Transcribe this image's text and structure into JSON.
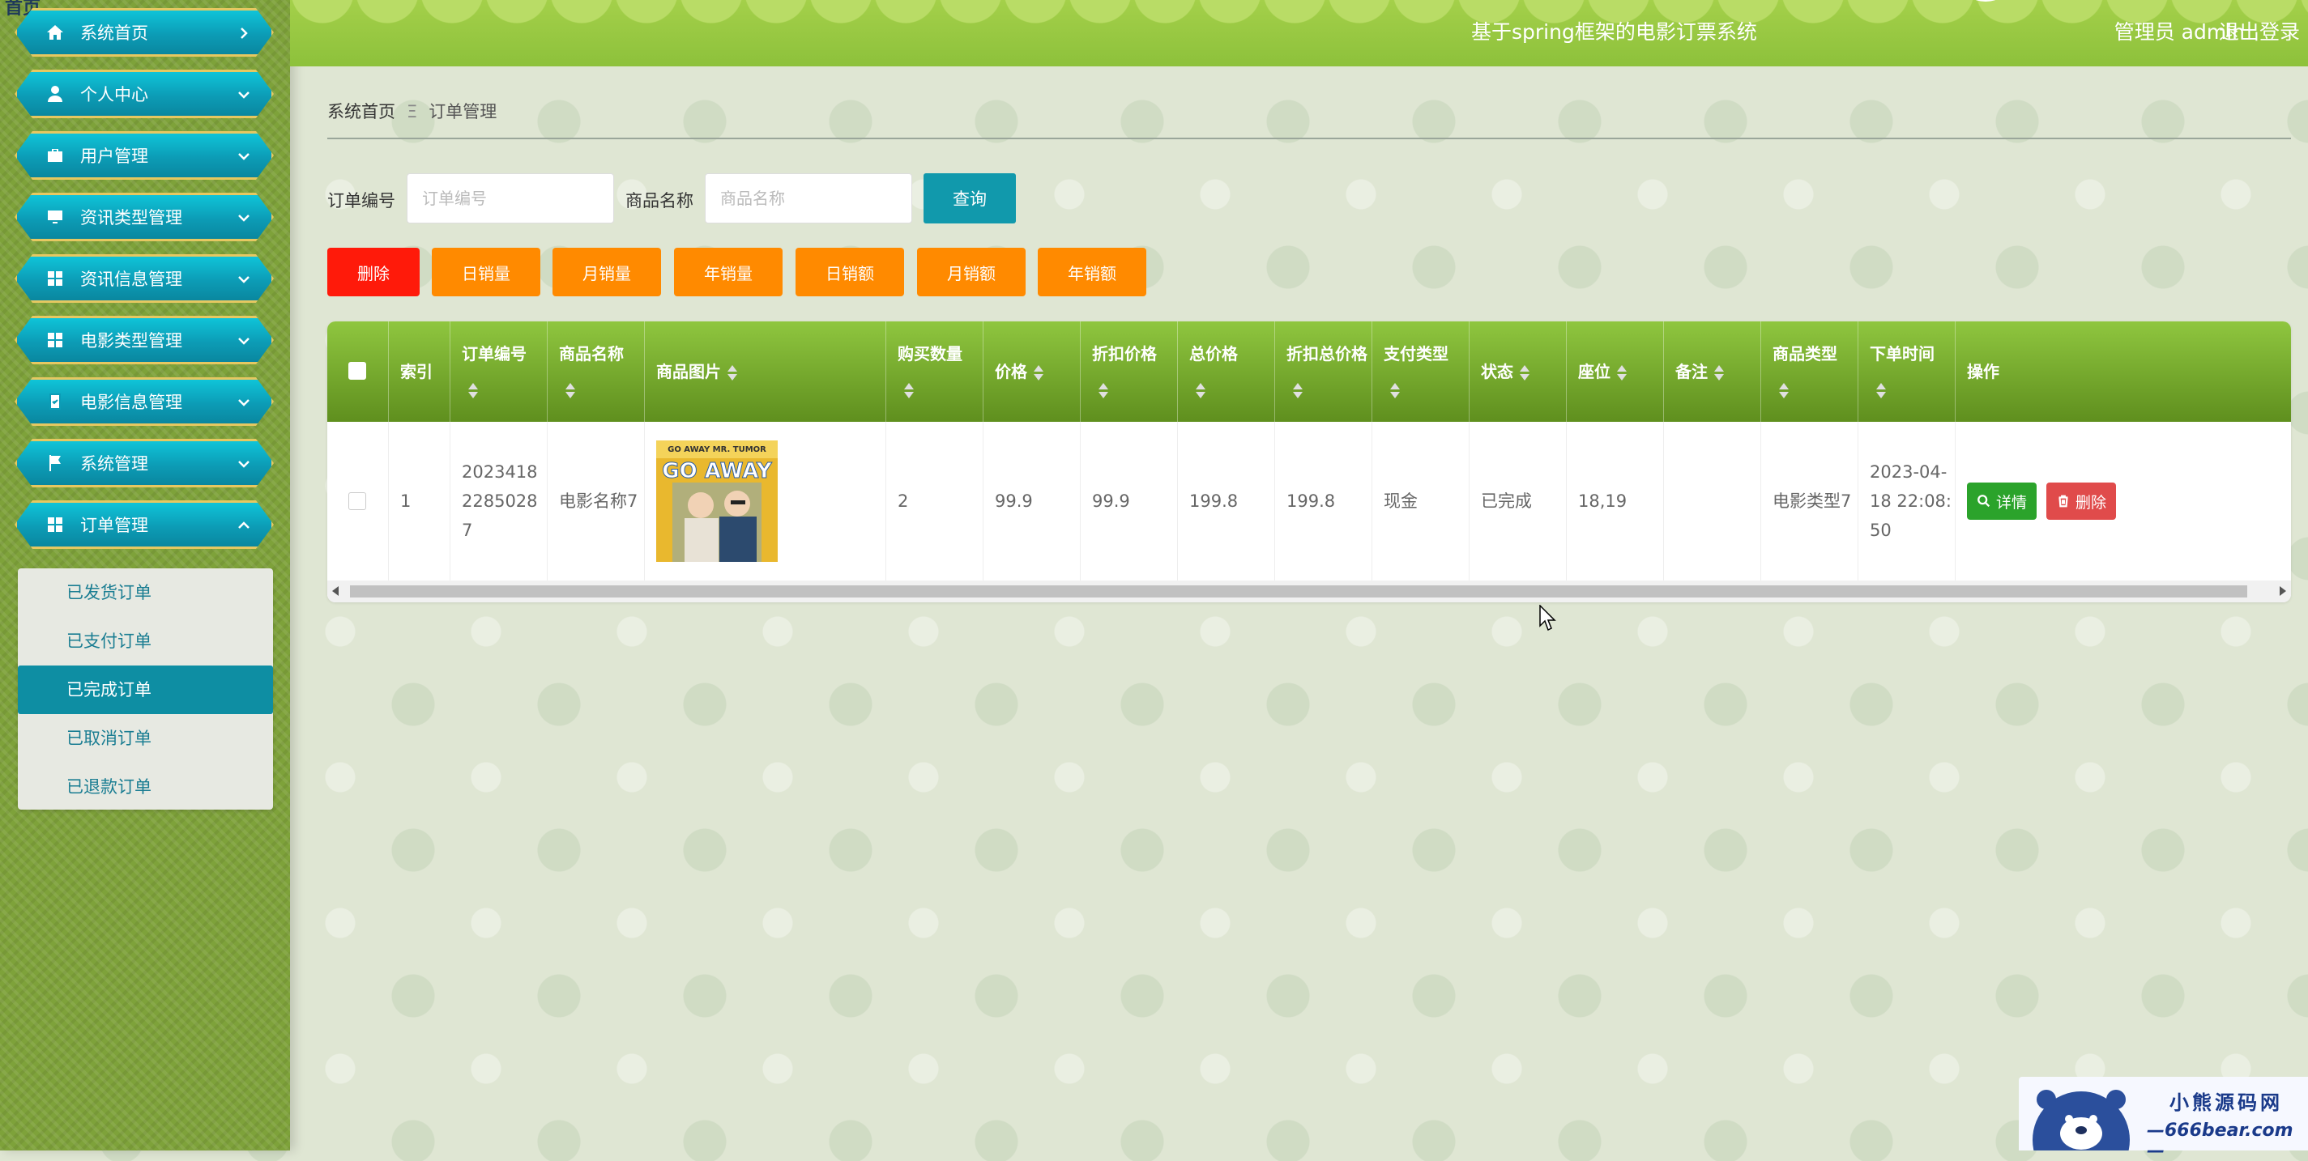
{
  "sidebar": {
    "top_tag": "首页",
    "items": [
      {
        "label": "系统首页",
        "icon": "home-icon"
      },
      {
        "label": "个人中心",
        "icon": "user-icon"
      },
      {
        "label": "用户管理",
        "icon": "briefcase-icon"
      },
      {
        "label": "资讯类型管理",
        "icon": "monitor-icon"
      },
      {
        "label": "资讯信息管理",
        "icon": "grid-icon"
      },
      {
        "label": "电影类型管理",
        "icon": "grid-icon"
      },
      {
        "label": "电影信息管理",
        "icon": "clipboard-check-icon"
      },
      {
        "label": "系统管理",
        "icon": "flag-icon"
      },
      {
        "label": "订单管理",
        "icon": "grid-icon"
      }
    ],
    "submenu": [
      {
        "label": "已发货订单",
        "active": false
      },
      {
        "label": "已支付订单",
        "active": false
      },
      {
        "label": "已完成订单",
        "active": true
      },
      {
        "label": "已取消订单",
        "active": false
      },
      {
        "label": "已退款订单",
        "active": false
      }
    ]
  },
  "header": {
    "title": "基于spring框架的电影订票系统",
    "admin": "管理员 admin",
    "logout": "退出登录"
  },
  "breadcrumb": {
    "home": "系统首页",
    "separator": "Ξ",
    "current": "订单管理"
  },
  "search": {
    "order_no_label": "订单编号",
    "order_no_placeholder": "订单编号",
    "order_no_value": "",
    "product_label": "商品名称",
    "product_placeholder": "商品名称",
    "product_value": "",
    "query": "查询"
  },
  "actions": {
    "delete": "删除",
    "daily_qty": "日销量",
    "monthly_qty": "月销量",
    "yearly_qty": "年销量",
    "daily_amt": "日销额",
    "monthly_amt": "月销额",
    "yearly_amt": "年销额"
  },
  "table": {
    "headers": [
      "索引",
      "订单编号",
      "商品名称",
      "商品图片",
      "购买数量",
      "价格",
      "折扣价格",
      "总价格",
      "折扣总价格",
      "支付类型",
      "状态",
      "座位",
      "备注",
      "商品类型",
      "下单时间",
      "操作"
    ],
    "rows": [
      {
        "index": "1",
        "order_no": "20234182285028 7",
        "product_name": "电影名称7",
        "poster_text": "GO AWAY MR. TUMOR",
        "quantity": "2",
        "price": "99.9",
        "discount_price": "99.9",
        "total": "199.8",
        "discount_total": "199.8",
        "pay_type": "现金",
        "status": "已完成",
        "seat": "18,19",
        "remark": "",
        "product_type": "电影类型7",
        "order_time": "2023-04-18 22:08:50",
        "detail_btn": "详情",
        "delete_btn": "删除"
      }
    ]
  },
  "watermark": {
    "line1": "小熊源码网",
    "line2": "—666bear.com—"
  },
  "colors": {
    "nav_bg": "#0c9cb6",
    "header_bg": "#8dc13b",
    "delete_red": "#ff1a0a",
    "stat_orange": "#ff8a00",
    "query_teal": "#1199ac"
  }
}
